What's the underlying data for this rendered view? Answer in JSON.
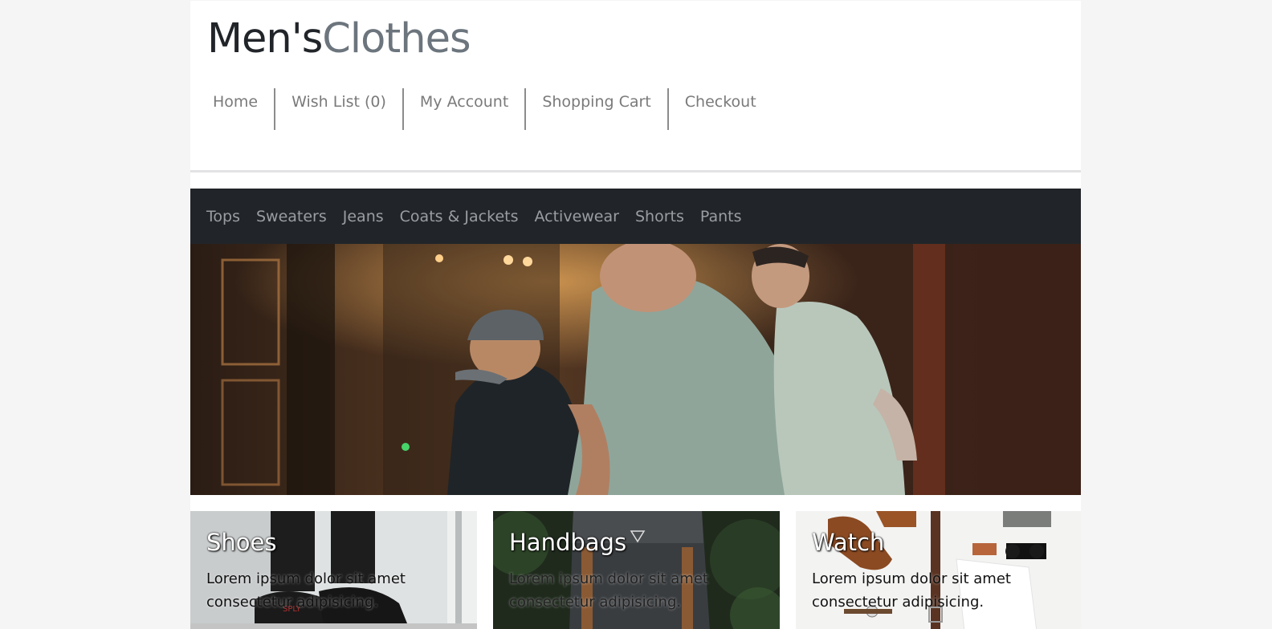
{
  "brand": {
    "part1": "Men's",
    "part2": "Clothes"
  },
  "top_nav": [
    "Home",
    "Wish List (0)",
    "My Account",
    "Shopping Cart",
    "Checkout"
  ],
  "categories": [
    "Tops",
    "Sweaters",
    "Jeans",
    "Coats & Jackets",
    "Activewear",
    "Shorts",
    "Pants"
  ],
  "cards": [
    {
      "title": "Shoes",
      "text": "Lorem ipsum dolor sit amet consectetur adipisicing."
    },
    {
      "title": "Handbags",
      "text": "Lorem ipsum dolor sit amet consectetur adipisicing."
    },
    {
      "title": "Watch",
      "text": "Lorem ipsum dolor sit amet consectetur adipisicing."
    }
  ],
  "colors": {
    "brand_dark": "#212529",
    "brand_muted": "#6c757d",
    "category_bar": "#212529",
    "page_bg": "#f5f5f5"
  }
}
